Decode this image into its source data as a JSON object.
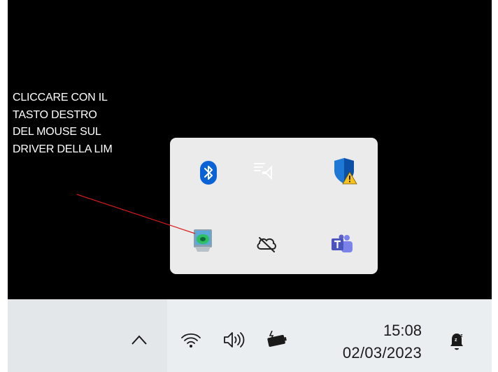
{
  "annotation": {
    "lines": [
      "CLICCARE CON IL",
      "TASTO DESTRO",
      "DEL MOUSE SUL",
      "DRIVER DELLA LIM"
    ]
  },
  "colors": {
    "pointer_line": "#d81b1b",
    "flyout_bg": "#ebebeb",
    "taskbar_bg": "#ebeef1",
    "bluetooth_blue": "#0a63d6",
    "teams_purple": "#5b5fc7"
  },
  "tray_flyout": {
    "icons": [
      {
        "name": "bluetooth-icon"
      },
      {
        "name": "remote-display-icon"
      },
      {
        "name": "windows-security-warning-icon"
      },
      {
        "name": "lim-driver-icon"
      },
      {
        "name": "onedrive-offline-icon"
      },
      {
        "name": "teams-icon"
      }
    ]
  },
  "taskbar": {
    "icons": [
      "chevron-up-icon",
      "wifi-icon",
      "volume-icon",
      "battery-charging-icon",
      "notification-bell-icon"
    ],
    "time": "15:08",
    "date": "02/03/2023"
  }
}
